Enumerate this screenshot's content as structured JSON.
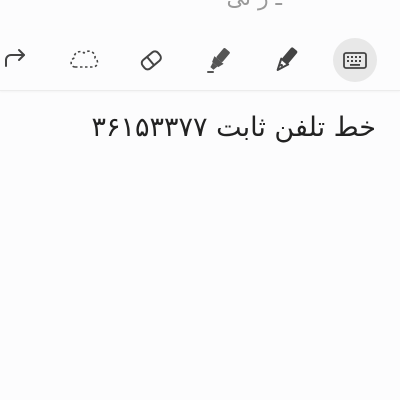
{
  "top_text_fragment": "ـ ر ثی",
  "toolbar": {
    "tools": [
      {
        "name": "redo",
        "icon": "redo-arrow-icon"
      },
      {
        "name": "lasso",
        "icon": "lasso-dashed-icon"
      },
      {
        "name": "eraser",
        "icon": "eraser-icon"
      },
      {
        "name": "highlighter",
        "icon": "highlighter-icon"
      },
      {
        "name": "pen",
        "icon": "pen-icon"
      },
      {
        "name": "keyboard",
        "icon": "keyboard-icon",
        "selected": true
      }
    ],
    "active_bg": "#e8e8e8",
    "icon_color": "#444444"
  },
  "note": {
    "text": "خط تلفن ثابت ۳۶۱۵۳۳۷۷"
  }
}
